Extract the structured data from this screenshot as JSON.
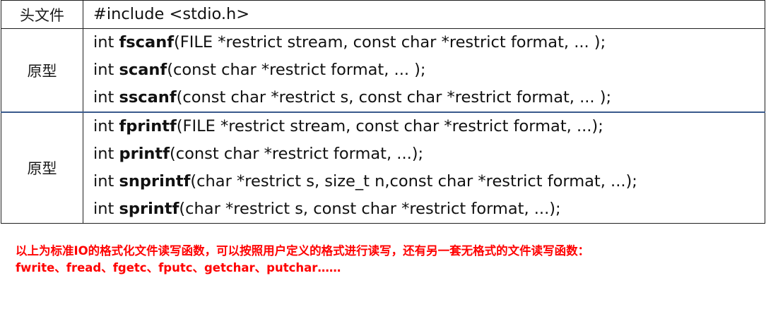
{
  "table_scanf": {
    "header_label": "头文件",
    "header_value": "#include <stdio.h>",
    "proto_label": "原型",
    "prototypes": [
      {
        "pre": "int ",
        "name": "fscanf",
        "args": "(FILE *restrict stream, const char *restrict format, ... );"
      },
      {
        "pre": "int ",
        "name": "scanf",
        "args": "(const char *restrict format, ... );"
      },
      {
        "pre": "int ",
        "name": "sscanf",
        "args": "(const char *restrict s, const char *restrict format, ... );"
      }
    ]
  },
  "table_printf": {
    "proto_label": "原型",
    "prototypes": [
      {
        "pre": "int ",
        "name": "fprintf",
        "args": "(FILE *restrict stream, const char *restrict format, ...);"
      },
      {
        "pre": "int ",
        "name": "printf",
        "args": "(const char *restrict format, ...);"
      },
      {
        "pre": "int ",
        "name": "snprintf",
        "args": "(char *restrict s, size_t n,const char *restrict format, ...);"
      },
      {
        "pre": "int ",
        "name": "sprintf",
        "args": "(char *restrict s, const char *restrict format, ...);"
      }
    ]
  },
  "note": {
    "line1": "以上为标准IO的格式化文件读写函数，可以按照用户定义的格式进行读写，还有另一套无格式的文件读写函数：",
    "line2": "fwrite、fread、fgetc、fputc、getchar、putchar……",
    "color": "#ff0000"
  }
}
